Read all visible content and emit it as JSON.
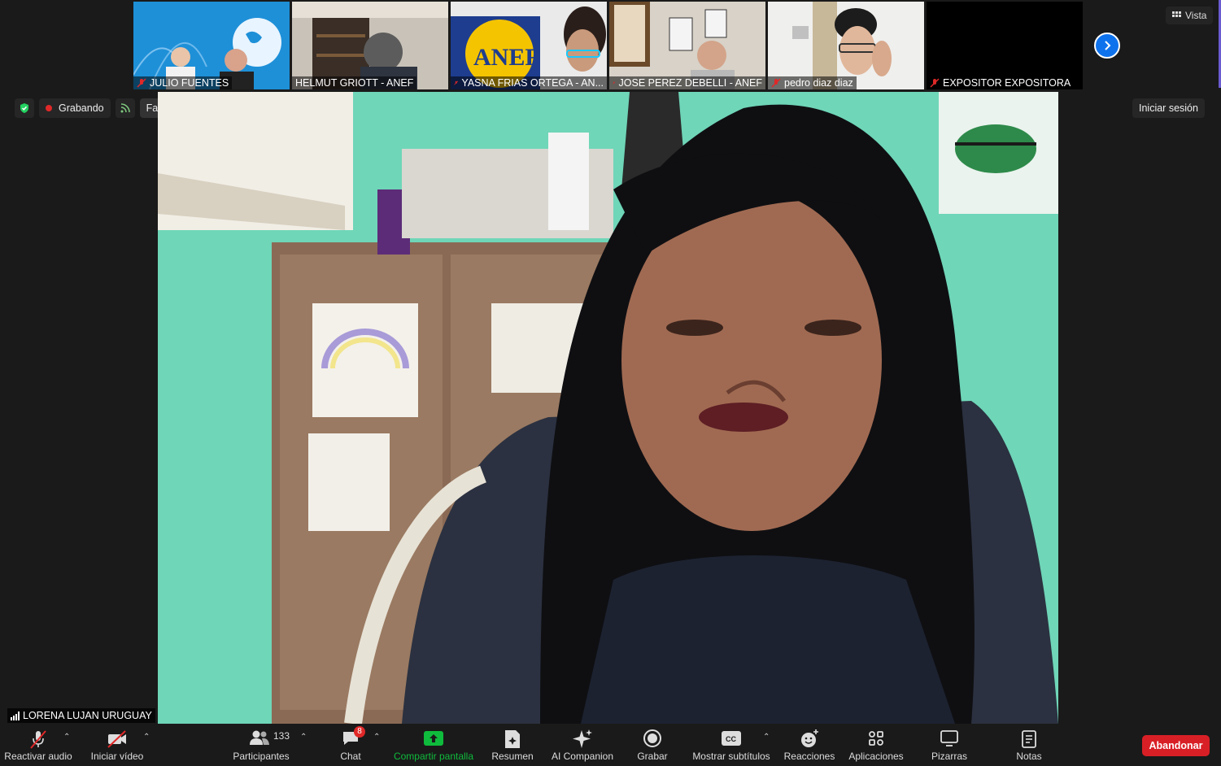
{
  "thumbnails": [
    {
      "name": "JULIO FUENTES"
    },
    {
      "name": "HELMUT GRIOTT - ANEF"
    },
    {
      "name": "YASNA FRIAS ORTEGA - AN..."
    },
    {
      "name": "JOSE PEREZ DEBELLI - ANEF"
    },
    {
      "name": "pedro diaz diaz"
    },
    {
      "name": "EXPOSITOR EXPOSITORA"
    }
  ],
  "view_button": "Vista",
  "top_bar": {
    "recording": "Grabando",
    "stream": "Facebook",
    "sign_in": "Iniciar sesión"
  },
  "speaker": {
    "name": "LORENA LUJAN URUGUAY"
  },
  "toolbar": {
    "unmute": "Reactivar audio",
    "start_video": "Iniciar vídeo",
    "participants": "Participantes",
    "participants_count": "133",
    "chat": "Chat",
    "chat_badge": "8",
    "share": "Compartir pantalla",
    "summary": "Resumen",
    "ai": "AI Companion",
    "record": "Grabar",
    "captions": "Mostrar subtítulos",
    "reactions": "Reacciones",
    "apps": "Aplicaciones",
    "whiteboards": "Pizarras",
    "notes": "Notas",
    "leave": "Abandonar"
  },
  "colors": {
    "accent_blue": "#0e72ed",
    "share_green": "#0fbb3c",
    "leave_red": "#d91f26",
    "wall_green": "#6fd6b8",
    "mic_off_red": "#e02828"
  }
}
